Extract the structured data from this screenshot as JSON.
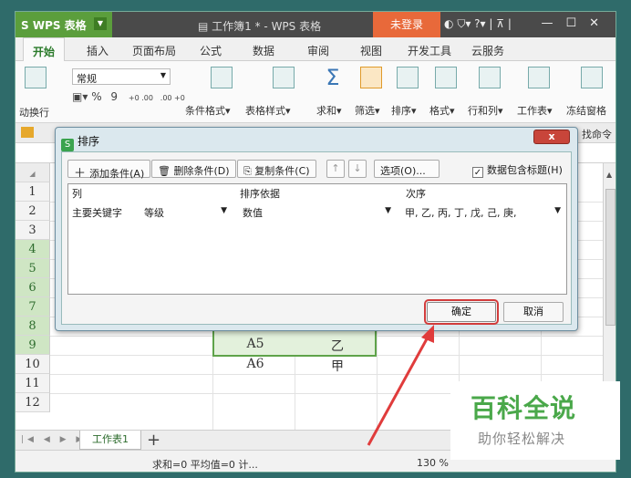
{
  "titlebar": {
    "app_name": "WPS 表格",
    "doc_title": "工作簿1 * - WPS 表格",
    "login_label": "未登录",
    "help_label": "?",
    "icons": [
      "skin-icon",
      "shirt-icon",
      "help-icon",
      "minimize-icon",
      "maximize-icon",
      "close-icon"
    ]
  },
  "menu": {
    "tabs": [
      "开始",
      "插入",
      "页面布局",
      "公式",
      "数据",
      "审阅",
      "视图",
      "开发工具",
      "云服务"
    ]
  },
  "ribbon": {
    "font_value": "常规",
    "wrap_label": "动换行",
    "percent_label": "%",
    "comma_label": "9",
    "dec_inc": "+0 .00",
    "dec_dec": ".00 +0",
    "cond_format": "条件格式",
    "table_style": "表格样式",
    "sum": "求和",
    "filter": "筛选",
    "sort": "排序",
    "format": "格式",
    "rowcol": "行和列",
    "worksheet": "工作表",
    "freeze": "冻结窗格",
    "find_cmd": "找命令"
  },
  "grid": {
    "row_numbers": [
      "1",
      "2",
      "3",
      "4",
      "5",
      "6",
      "7",
      "8",
      "9",
      "10",
      "11",
      "12"
    ],
    "col_label_h": "H",
    "cells": {
      "r8_a": "A5",
      "r8_b": "乙",
      "r9_a": "A6",
      "r9_b": "甲"
    }
  },
  "sheets": {
    "active": "工作表1",
    "add_label": "+"
  },
  "status": {
    "text": "求和=0  平均值=0  计...",
    "zoom": "130 %"
  },
  "dialog": {
    "title": "排序",
    "close_label": "x",
    "add_condition": "添加条件(A)",
    "delete_condition": "删除条件(D)",
    "copy_condition": "复制条件(C)",
    "move_up": "↑",
    "move_down": "↓",
    "options": "选项(O)...",
    "header_checkbox": "数据包含标题(H)",
    "header_checked": "✓",
    "columns": {
      "col": "列",
      "basis": "排序依据",
      "order": "次序"
    },
    "row": {
      "key_label": "主要关键字",
      "key_value": "等级",
      "basis_value": "数值",
      "order_value": "甲, 乙, 丙, 丁, 戊, 己, 庚,"
    },
    "ok": "确定",
    "cancel": "取消"
  },
  "watermark": {
    "title": "百科全说",
    "subtitle": "助你轻松解决"
  },
  "colors": {
    "accent_green": "#5b9e3c",
    "login_orange": "#e8693a",
    "highlight_red": "#d23c3c"
  }
}
